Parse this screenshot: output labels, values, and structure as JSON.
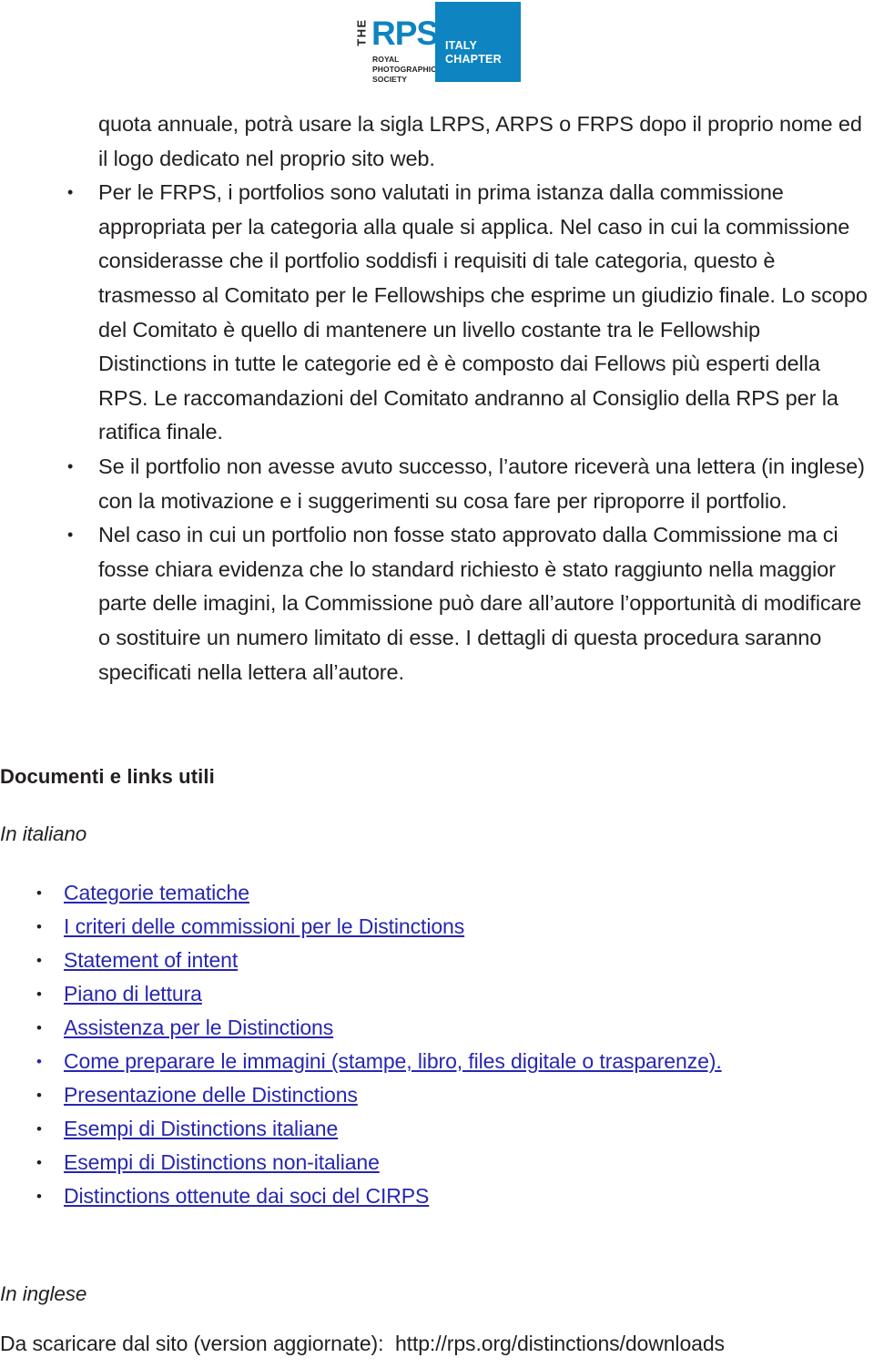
{
  "header": {
    "logo": {
      "the": "THE",
      "rps": "RPS",
      "society": "ROYAL\nPHOTOGRAPHIC\nSOCIETY",
      "chapter": "ITALY\nCHAPTER",
      "brand_blue": "#0e84c0"
    }
  },
  "body": {
    "continuation_paragraph": "quota annuale, potrà usare la sigla LRPS, ARPS o FRPS dopo il proprio nome ed il logo dedicato nel proprio sito web.",
    "bullets": [
      "Per le FRPS, i portfolios sono valutati in prima istanza dalla commissione appropriata per la categoria alla quale si applica. Nel caso in cui la commissione considerasse che il portfolio soddisfi i requisiti di tale categoria, questo è trasmesso al Comitato per le Fellowships che esprime un giudizio finale. Lo scopo del Comitato è quello di mantenere un livello costante tra le Fellowship Distinctions in tutte le categorie ed è è composto dai Fellows più esperti della RPS. Le raccomandazioni del Comitato andranno al Consiglio della RPS per la ratifica finale.",
      "Se il portfolio  non avesse avuto successo, l’autore riceverà una lettera (in inglese) con la motivazione e i suggerimenti su cosa fare per riproporre il portfolio.",
      "Nel caso in cui un portfolio non fosse stato approvato dalla Commissione ma ci fosse chiara evidenza che lo standard richiesto è stato raggiunto nella maggior parte delle imagini, la Commissione può dare all’autore l’opportunità di modificare o sostituire un numero limitato di esse. I dettagli di questa procedura saranno specificati nella lettera all’autore."
    ]
  },
  "resources": {
    "heading": "Documenti e links utili",
    "italian_label": "In italiano",
    "english_label": "In inglese",
    "link_color": "#2727b0",
    "italian_links": [
      {
        "label": "Categorie tematiche",
        "blue_marker": false
      },
      {
        "label": "I criteri delle commissioni per le Distinctions",
        "blue_marker": false
      },
      {
        "label": "Statement of intent",
        "blue_marker": false
      },
      {
        "label": "Piano di lettura",
        "blue_marker": false
      },
      {
        "label": "Assistenza per le Distinctions",
        "blue_marker": false
      },
      {
        "label": "Come preparare le immagini (stampe, libro, files digitale o trasparenze).",
        "blue_marker": true
      },
      {
        "label": "Presentazione delle Distinctions",
        "blue_marker": false
      },
      {
        "label": "Esempi di Distinctions italiane",
        "blue_marker": false
      },
      {
        "label": "Esempi di Distinctions non-italiane",
        "blue_marker": false
      },
      {
        "label": "Distinctions ottenute dai soci del CIRPS",
        "blue_marker": false
      }
    ],
    "english_footer": "Da scaricare dal sito (version aggiornate):  http://rps.org/distinctions/downloads"
  }
}
